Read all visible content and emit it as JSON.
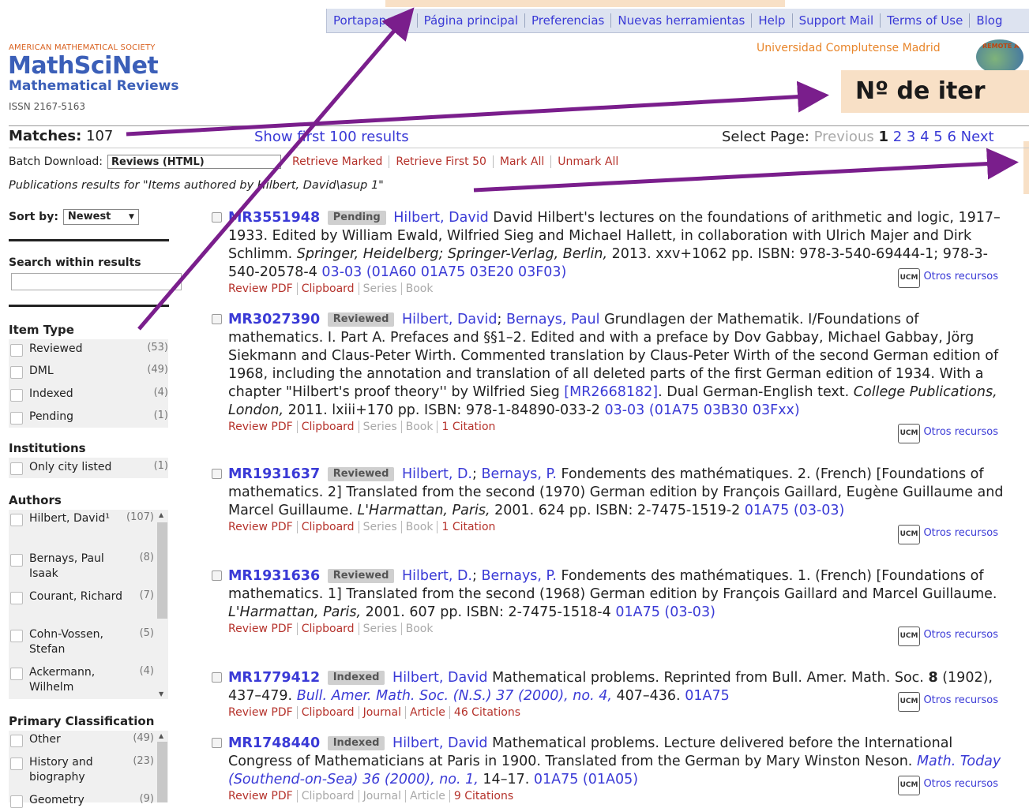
{
  "topnav": [
    "Portapapeles",
    "Página principal",
    "Preferencias",
    "Nuevas herramientas",
    "Help",
    "Support Mail",
    "Terms of Use",
    "Blog"
  ],
  "header": {
    "society": "AMERICAN MATHEMATICAL SOCIETY",
    "logo": "MathSciNet",
    "subtitle": "Mathematical Reviews",
    "issn": "ISSN 2167-5163",
    "institution": "Universidad Complutense Madrid",
    "remote_badge": "REMOTE A"
  },
  "callout": {
    "items_label": "Nº de iter"
  },
  "results_bar": {
    "matches_label": "Matches:",
    "matches_count": "107",
    "show_first": "Show first 100 results",
    "select_page_label": "Select Page:",
    "previous": "Previous",
    "current_page": "1",
    "pages": [
      "2",
      "3",
      "4",
      "5",
      "6"
    ],
    "next": "Next"
  },
  "batch": {
    "label": "Batch Download:",
    "selected": "Reviews (HTML)",
    "links": [
      "Retrieve Marked",
      "Retrieve First 50",
      "Mark All",
      "Unmark All"
    ]
  },
  "query_text": "Publications results for \"Items authored by Hilbert, David\\asup 1\"",
  "sidebar": {
    "sort_label": "Sort by:",
    "sort_value": "Newest",
    "search_within": "Search within results",
    "item_type": {
      "title": "Item Type",
      "items": [
        {
          "label": "Reviewed",
          "count": "(53)"
        },
        {
          "label": "DML",
          "count": "(49)"
        },
        {
          "label": "Indexed",
          "count": "(4)"
        },
        {
          "label": "Pending",
          "count": "(1)"
        }
      ]
    },
    "institutions": {
      "title": "Institutions",
      "items": [
        {
          "label": "Only city listed",
          "count": "(1)"
        }
      ]
    },
    "authors": {
      "title": "Authors",
      "items": [
        {
          "label": "Hilbert, David¹",
          "count": "(107)"
        },
        {
          "label": "Bernays, Paul Isaak",
          "count": "(8)"
        },
        {
          "label": "Courant, Richard",
          "count": "(7)"
        },
        {
          "label": "Cohn-Vossen, Stefan",
          "count": "(5)"
        },
        {
          "label": "Ackermann, Wilhelm",
          "count": "(4)"
        }
      ]
    },
    "classification": {
      "title": "Primary Classification",
      "items": [
        {
          "label": "Other",
          "count": "(49)"
        },
        {
          "label": "History and biography",
          "count": "(23)"
        },
        {
          "label": "Geometry",
          "count": "(9)"
        }
      ]
    }
  },
  "otros_label": "Otros recursos",
  "ucm_label": "UCM",
  "results": [
    {
      "mr": "MR3551948",
      "status": "Pending",
      "authors": [
        "Hilbert, David"
      ],
      "text": "David Hilbert's lectures on the foundations of arithmetic and logic, 1917–1933. Edited by William Ewald, Wilfried Sieg and Michael Hallett, in collaboration with Ulrich Majer and Dirk Schlimm.",
      "journal": "Springer, Heidelberg; Springer-Verlag, Berlin,",
      "tail": "2013. xxv+1062 pp. ISBN: 978-3-540-69444-1; 978-3-540-20578-4",
      "classes": "03-03 (01A60 01A75 03E20 03F03)",
      "links": [
        "Review PDF",
        "Clipboard",
        "Series",
        "Book"
      ],
      "citations": ""
    },
    {
      "mr": "MR3027390",
      "status": "Reviewed",
      "authors": [
        "Hilbert, David",
        "Bernays, Paul"
      ],
      "text": "Grundlagen der Mathematik. I/Foundations of mathematics. I. Part A. Prefaces and §§1–2. Edited and with a preface by Dov Gabbay, Michael Gabbay, Jörg Siekmann and Claus-Peter Wirth. Commented translation by Claus-Peter Wirth of the second German edition of 1968, including the annotation and translation of all deleted parts of the first German edition of 1934. With a chapter \"Hilbert's proof theory'' by Wilfried Sieg",
      "ref": "[MR2668182]",
      "after_ref": ". Dual German-English text.",
      "journal": "College Publications, London,",
      "tail": "2011. lxiii+170 pp. ISBN: 978-1-84890-033-2",
      "classes": "03-03 (01A75 03B30 03Fxx)",
      "links": [
        "Review PDF",
        "Clipboard",
        "Series",
        "Book"
      ],
      "citations": "1 Citation"
    },
    {
      "mr": "MR1931637",
      "status": "Reviewed",
      "authors": [
        "Hilbert, D.",
        "Bernays, P."
      ],
      "text": "Fondements des mathématiques. 2. (French) [Foundations of mathematics. 2] Translated from the second (1970) German edition by François Gaillard, Eugène Guillaume and Marcel Guillaume.",
      "journal": "L'Harmattan, Paris,",
      "tail": "2001. 624 pp. ISBN: 2-7475-1519-2",
      "classes": "01A75 (03-03)",
      "links": [
        "Review PDF",
        "Clipboard",
        "Series",
        "Book"
      ],
      "citations": "1 Citation"
    },
    {
      "mr": "MR1931636",
      "status": "Reviewed",
      "authors": [
        "Hilbert, D.",
        "Bernays, P."
      ],
      "text": "Fondements des mathématiques. 1. (French) [Foundations of mathematics. 1] Translated from the second (1968) German edition by François Gaillard and Marcel Guillaume.",
      "journal": "L'Harmattan, Paris,",
      "tail": "2001. 607 pp. ISBN: 2-7475-1518-4",
      "classes": "01A75 (03-03)",
      "links": [
        "Review PDF",
        "Clipboard",
        "Series",
        "Book"
      ],
      "citations": ""
    },
    {
      "mr": "MR1779412",
      "status": "Indexed",
      "authors": [
        "Hilbert, David"
      ],
      "text": "Mathematical problems. Reprinted from Bull. Amer. Math. Soc.",
      "bold": "8",
      "after_bold": "(1902), 437–479.",
      "journal_link": "Bull. Amer. Math. Soc. (N.S.) 37 (2000), no. 4,",
      "tail": "407–436.",
      "classes": "01A75",
      "links": [
        "Review PDF",
        "Clipboard",
        "Journal",
        "Article"
      ],
      "citations": "46 Citations"
    },
    {
      "mr": "MR1748440",
      "status": "Indexed",
      "authors": [
        "Hilbert, David"
      ],
      "text": "Mathematical problems. Lecture delivered before the International Congress of Mathematicians at Paris in 1900. Translated from the German by Mary Winston Neson.",
      "journal_link": "Math. Today (Southend-on-Sea) 36 (2000), no. 1,",
      "tail": "14–17.",
      "classes": "01A75 (01A05)",
      "links": [
        "Review PDF",
        "Clipboard",
        "Journal",
        "Article"
      ],
      "citations": "9 Citations"
    }
  ]
}
